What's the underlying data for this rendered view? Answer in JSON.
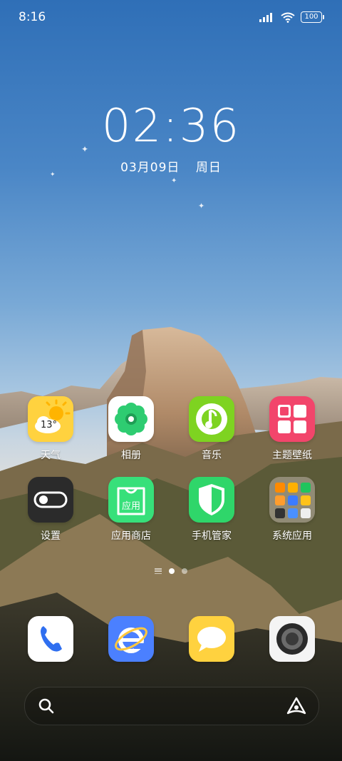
{
  "status_bar": {
    "time": "8:16",
    "battery": "100"
  },
  "clock_widget": {
    "time": "02:36",
    "date": "03月09日",
    "weekday": "周日"
  },
  "apps": [
    {
      "label": "天气",
      "icon": "weather-icon",
      "badge": "13°",
      "color": "#ffd23f"
    },
    {
      "label": "相册",
      "icon": "gallery-icon",
      "color": "#ffffff"
    },
    {
      "label": "音乐",
      "icon": "music-icon",
      "color": "#7ed321"
    },
    {
      "label": "主题壁纸",
      "icon": "themes-icon",
      "color": "#f2456b"
    },
    {
      "label": "设置",
      "icon": "settings-icon",
      "color": "#2b2b2b"
    },
    {
      "label": "应用商店",
      "icon": "app-store-icon",
      "badge": "应用",
      "color": "#37e07a"
    },
    {
      "label": "手机管家",
      "icon": "security-icon",
      "color": "#2fd66a"
    },
    {
      "label": "系统应用",
      "icon": "folder-icon",
      "color": "#9aa0a6"
    }
  ],
  "dock": [
    {
      "name": "phone-icon",
      "color": "#ffffff"
    },
    {
      "name": "browser-icon",
      "color": "#4b80ff"
    },
    {
      "name": "messages-icon",
      "color": "#ffd23f"
    },
    {
      "name": "camera-icon",
      "color": "#ffffff"
    }
  ],
  "pages": {
    "current": 1,
    "total": 2
  }
}
